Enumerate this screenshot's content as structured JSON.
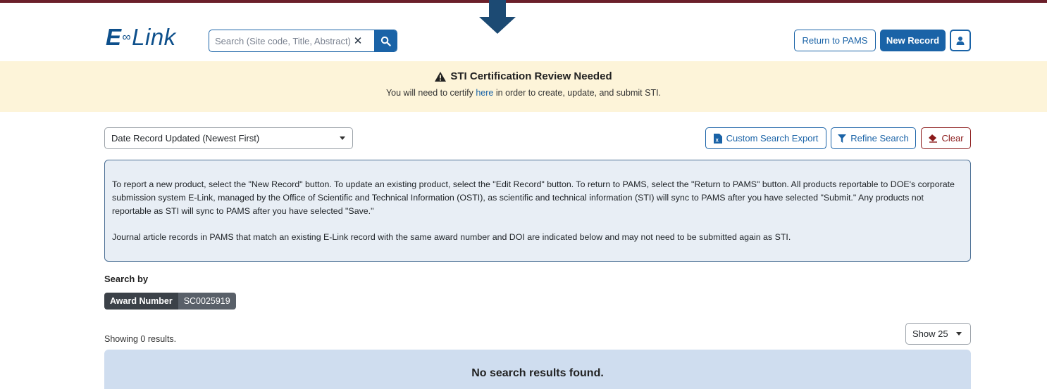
{
  "header": {
    "logo_e": "E",
    "logo_infinity": "∞",
    "logo_link": "Link",
    "search_placeholder": "Search (Site code, Title, Abstract)",
    "return_button": "Return to PAMS",
    "new_record_button": "New Record"
  },
  "banner": {
    "title": "STI Certification Review Needed",
    "sub_before": "You will need to certify ",
    "sub_link": "here",
    "sub_after": " in order to create, update, and submit STI."
  },
  "toolbar": {
    "sort_selected": "Date Record Updated (Newest First)",
    "custom_export": "Custom Search Export",
    "refine_search": "Refine Search",
    "clear": "Clear"
  },
  "info": {
    "paragraph1": "To report a new product, select the \"New Record\" button. To update an existing product, select the \"Edit Record\" button. To return to PAMS, select the \"Return to PAMS\" button. All products reportable to DOE's corporate submission system E-Link, managed by the Office of Scientific and Technical Information (OSTI), as scientific and technical information (STI) will sync to PAMS after you have selected \"Submit.\" Any products not reportable as STI will sync to PAMS after you have selected \"Save.\"",
    "paragraph2": "Journal article records in PAMS that match an existing E-Link record with the same award number and DOI are indicated below and may not need to be submitted again as STI."
  },
  "filters": {
    "heading": "Search by",
    "chip_key": "Award Number",
    "chip_value": "SC0025919"
  },
  "results": {
    "showing": "Showing 0 results.",
    "page_size": "Show 25",
    "empty_message": "No search results found."
  },
  "colors": {
    "primary": "#1a63a7",
    "banner_bg": "#fdf4d9",
    "danger": "#8b1a1a",
    "top_line": "#6b1f2a",
    "arrow": "#1c4a73"
  }
}
